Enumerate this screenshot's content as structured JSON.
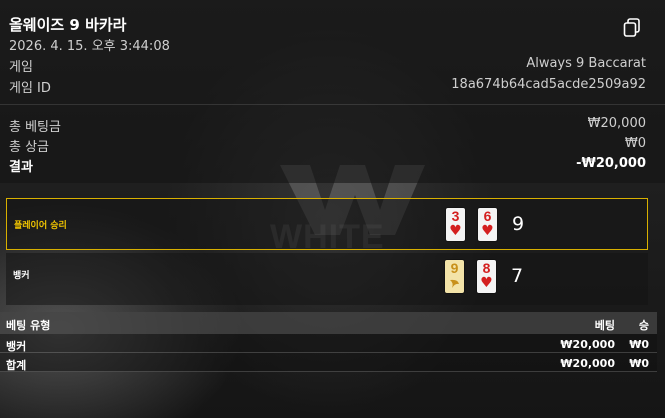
{
  "header": {
    "title": "올웨이즈 9 바카라",
    "datetime": "2026. 4. 15. 오후 3:44:08"
  },
  "info": [
    {
      "label": "게임",
      "value": "Always 9 Baccarat"
    },
    {
      "label": "게임 ID",
      "value": "18a674b64cad5acde2509a92"
    }
  ],
  "summary": {
    "total_bet_label": "총 베팅금",
    "total_bet_value": "₩20,000",
    "total_win_label": "총 상금",
    "total_win_value": "₩0",
    "result_label": "결과",
    "result_value": "-₩20,000"
  },
  "outcome": {
    "player": {
      "label": "플레이어 승리",
      "cards": [
        {
          "rank": "3",
          "suit": "♥"
        },
        {
          "rank": "6",
          "suit": "♥"
        }
      ],
      "score": "9"
    },
    "banker": {
      "label": "뱅커",
      "cards": [
        {
          "rank": "9",
          "suit": "gold-special"
        },
        {
          "rank": "8",
          "suit": "♥"
        }
      ],
      "score": "7"
    }
  },
  "bets_table": {
    "headers": [
      "베팅 유형",
      "베팅",
      "승"
    ],
    "rows": [
      [
        "뱅커",
        "₩20,000",
        "₩0"
      ],
      [
        "합계",
        "₩20,000",
        "₩0"
      ]
    ]
  },
  "watermark": "WHITE",
  "colors": {
    "win_border": "#d8b000",
    "card_red": "#d41f1f",
    "gold_card": "#f3e3a8"
  },
  "icons": [
    "copy-icon"
  ]
}
